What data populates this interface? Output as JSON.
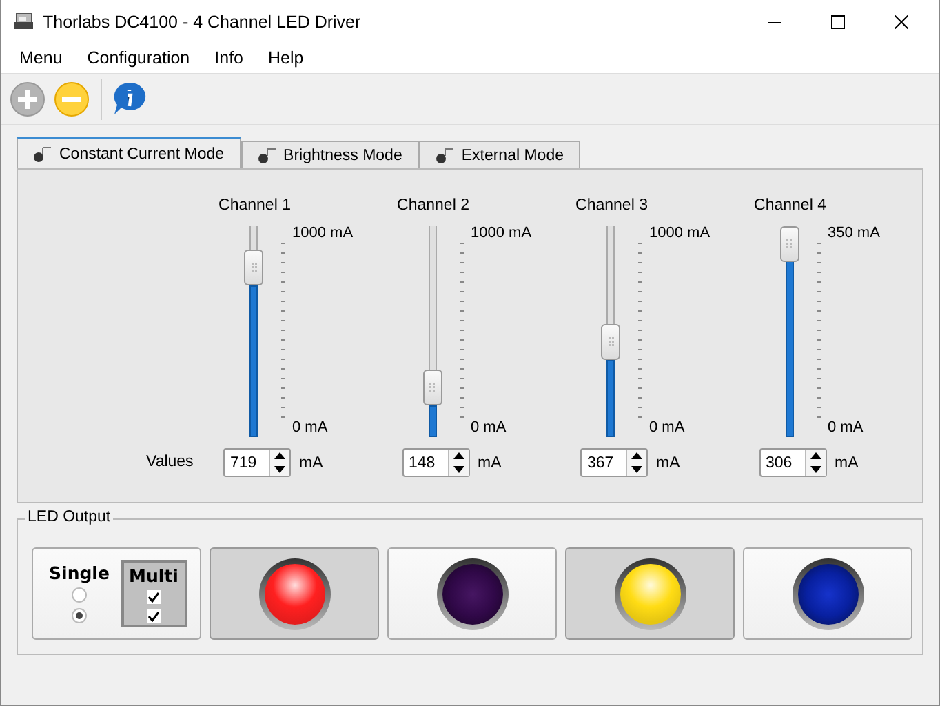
{
  "window": {
    "title": "Thorlabs DC4100 - 4 Channel LED Driver"
  },
  "menu": [
    "Menu",
    "Configuration",
    "Info",
    "Help"
  ],
  "tabs": [
    {
      "label": "Constant Current Mode",
      "selected": true
    },
    {
      "label": "Brightness Mode",
      "selected": false
    },
    {
      "label": "External Mode",
      "selected": false
    }
  ],
  "values_label": "Values",
  "channels": [
    {
      "name": "Channel 1",
      "max": "1000 mA",
      "min": "0 mA",
      "level": 0.719,
      "value": "719",
      "unit": "mA"
    },
    {
      "name": "Channel 2",
      "max": "1000 mA",
      "min": "0 mA",
      "level": 0.148,
      "value": "148",
      "unit": "mA"
    },
    {
      "name": "Channel 3",
      "max": "1000 mA",
      "min": "0 mA",
      "level": 0.367,
      "value": "367",
      "unit": "mA"
    },
    {
      "name": "Channel 4",
      "max": "350 mA",
      "min": "0 mA",
      "level": 0.874,
      "value": "306",
      "unit": "mA"
    }
  ],
  "led_output": {
    "title": "LED Output",
    "single": {
      "label": "Single",
      "selected": false,
      "radios": [
        {
          "selected": false
        },
        {
          "selected": true
        }
      ]
    },
    "multi": {
      "label": "Multi",
      "selected": true,
      "checks": [
        {
          "checked": true
        },
        {
          "checked": true
        }
      ]
    },
    "leds": [
      {
        "color": "#ff2020",
        "on": true
      },
      {
        "color": "#3c0a5a",
        "on": false
      },
      {
        "color": "#ffdc14",
        "on": true
      },
      {
        "color": "#0a28c8",
        "on": false
      }
    ]
  }
}
